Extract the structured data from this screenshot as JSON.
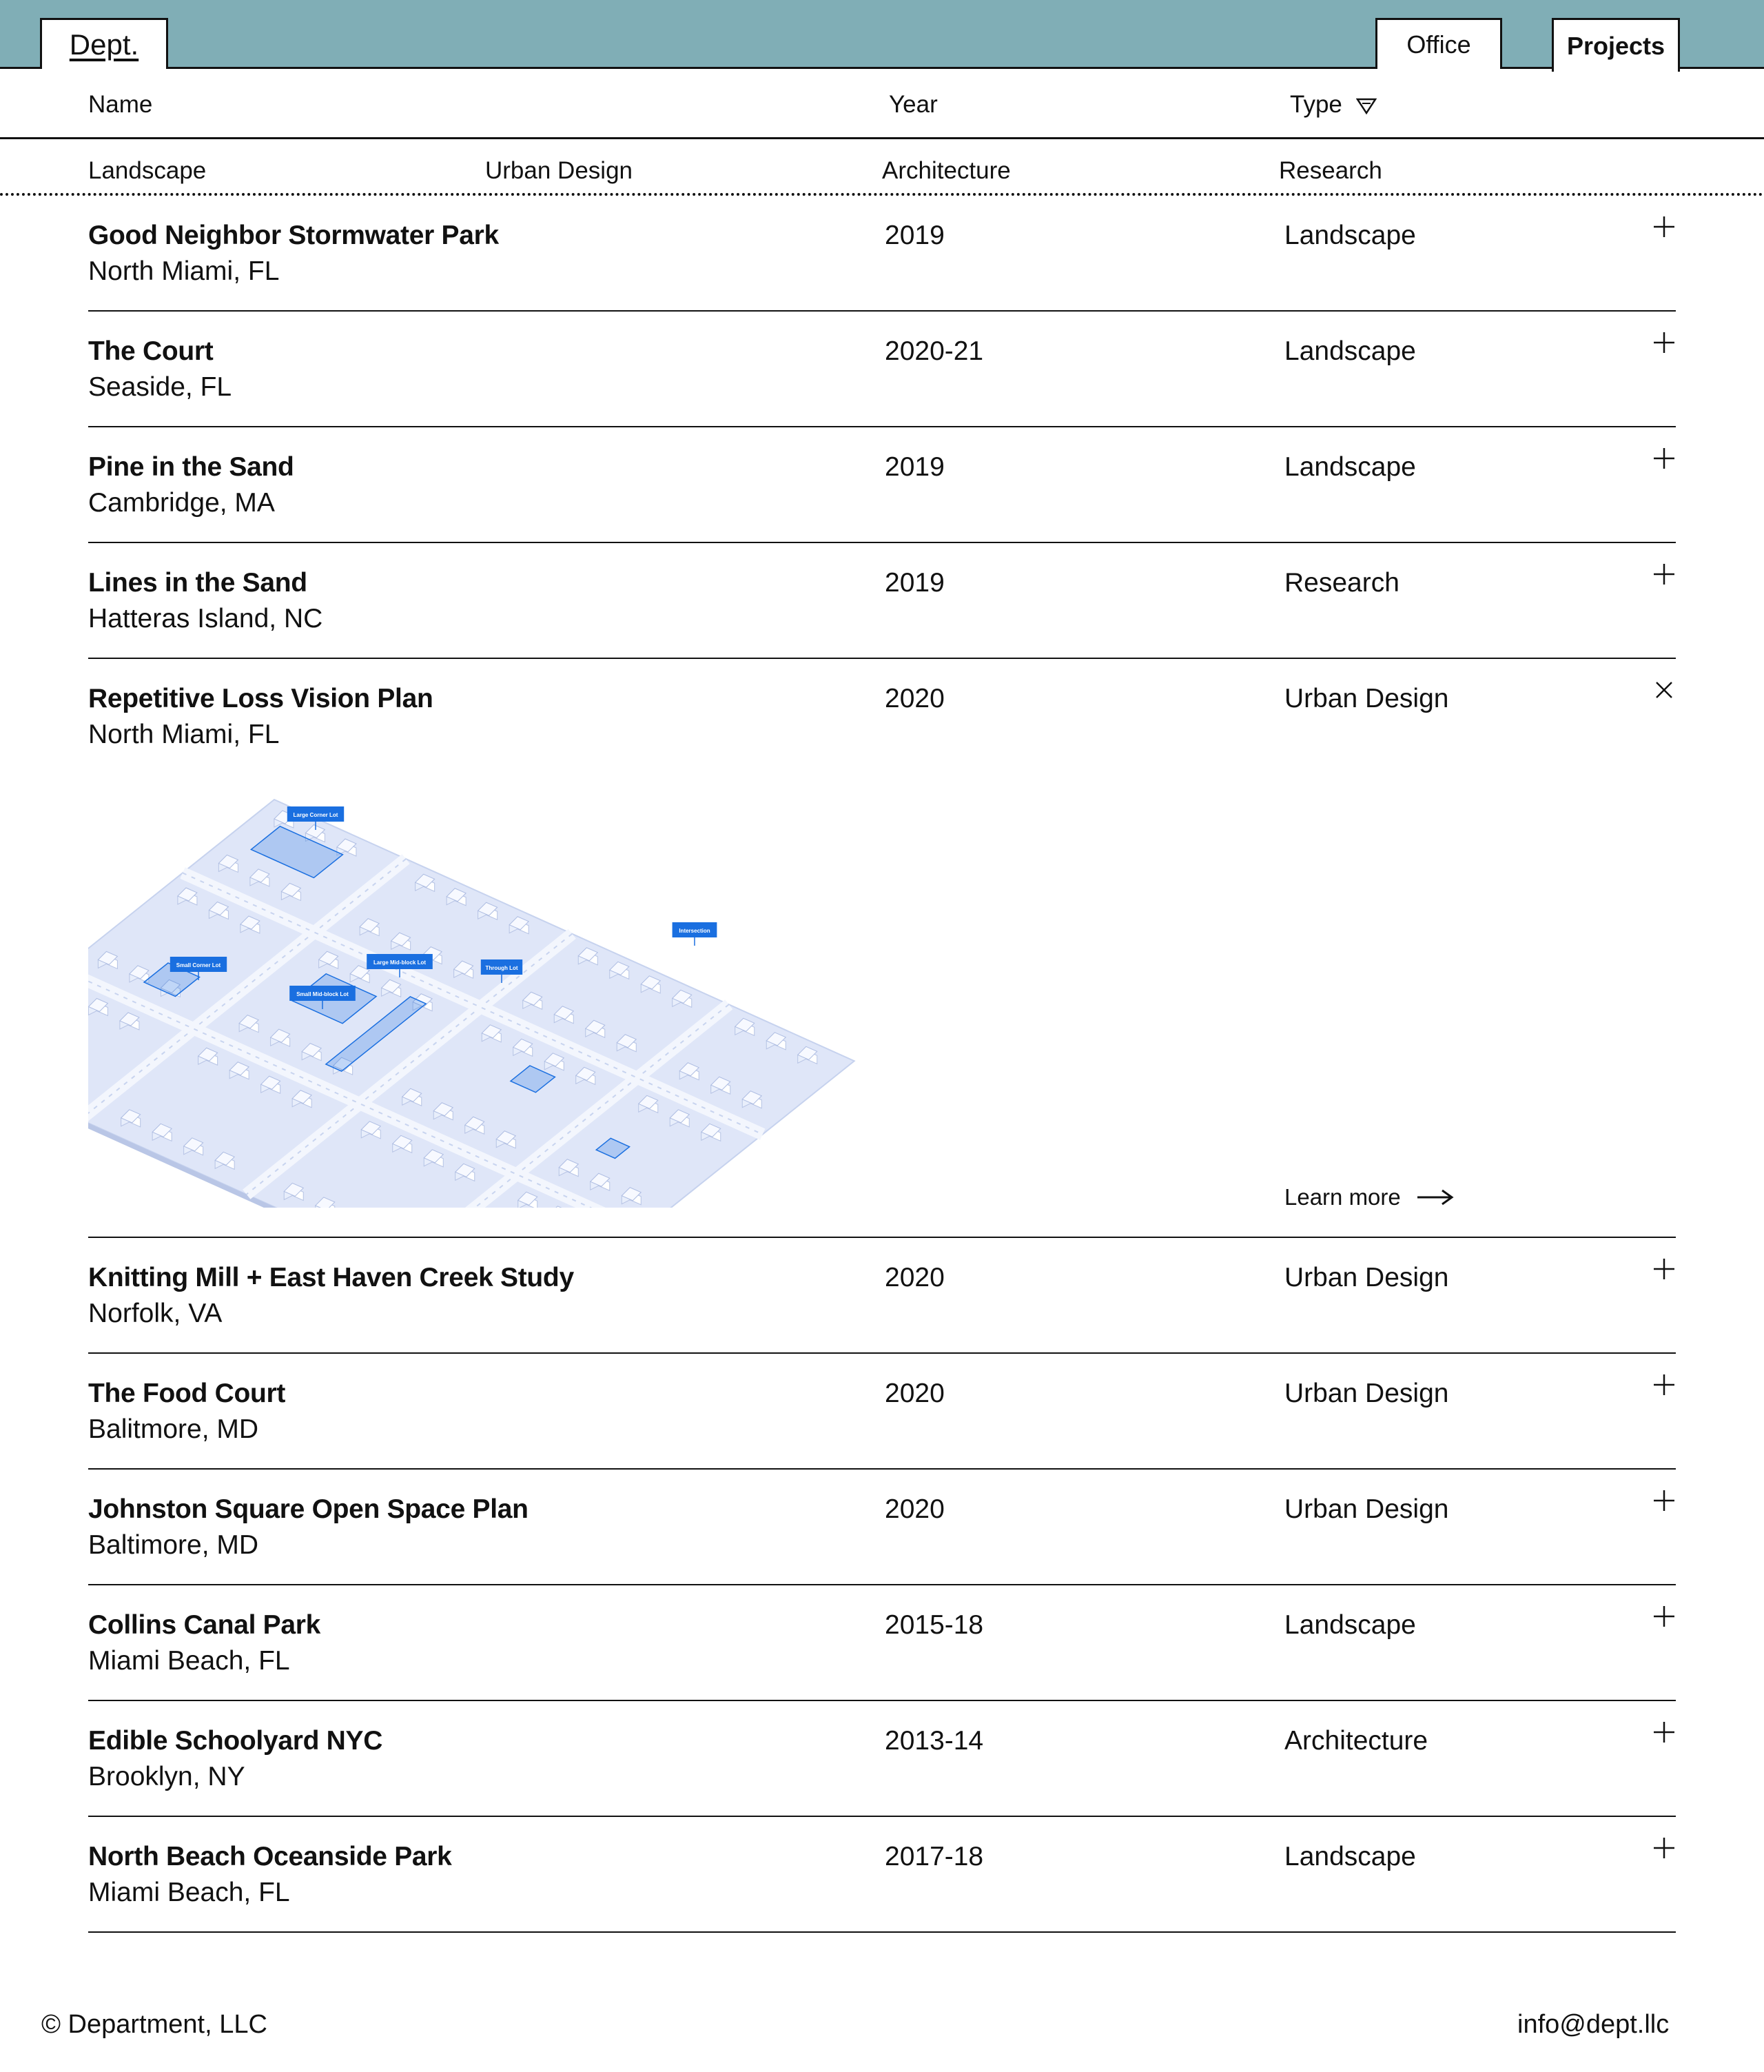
{
  "header": {
    "logo": "Dept.",
    "nav": {
      "office": "Office",
      "projects": "Projects"
    }
  },
  "columns": {
    "name": "Name",
    "year": "Year",
    "type": "Type"
  },
  "filters": [
    "Landscape",
    "Urban Design",
    "Architecture",
    "Research"
  ],
  "projects": [
    {
      "title": "Good Neighbor Stormwater Park",
      "location": "North Miami, FL",
      "year": "2019",
      "type": "Landscape",
      "expanded": false
    },
    {
      "title": "The Court",
      "location": "Seaside, FL",
      "year": "2020-21",
      "type": "Landscape",
      "expanded": false
    },
    {
      "title": "Pine in the Sand",
      "location": "Cambridge, MA",
      "year": "2019",
      "type": "Landscape",
      "expanded": false
    },
    {
      "title": "Lines in the Sand",
      "location": "Hatteras Island, NC",
      "year": "2019",
      "type": "Research",
      "expanded": false
    },
    {
      "title": "Repetitive Loss Vision Plan",
      "location": "North Miami, FL",
      "year": "2020",
      "type": "Urban Design",
      "expanded": true,
      "learn_more": "Learn more",
      "image_labels": [
        "Large Corner Lot",
        "Intersection",
        "Small Corner Lot",
        "Large Mid-block Lot",
        "Through Lot",
        "Small Mid-block Lot"
      ]
    },
    {
      "title": "Knitting Mill + East Haven Creek Study",
      "location": "Norfolk, VA",
      "year": "2020",
      "type": "Urban Design",
      "expanded": false
    },
    {
      "title": "The Food Court",
      "location": "Balitmore, MD",
      "year": "2020",
      "type": "Urban Design",
      "expanded": false
    },
    {
      "title": "Johnston Square Open Space Plan",
      "location": "Baltimore, MD",
      "year": "2020",
      "type": "Urban Design",
      "expanded": false
    },
    {
      "title": "Collins Canal Park",
      "location": "Miami Beach, FL",
      "year": "2015-18",
      "type": "Landscape",
      "expanded": false
    },
    {
      "title": "Edible Schoolyard NYC",
      "location": "Brooklyn, NY",
      "year": "2013-14",
      "type": "Architecture",
      "expanded": false
    },
    {
      "title": "North Beach Oceanside Park",
      "location": "Miami Beach, FL",
      "year": "2017-18",
      "type": "Landscape",
      "expanded": false
    }
  ],
  "footer": {
    "copyright": "© Department, LLC",
    "email": "info@dept.llc"
  },
  "colors": {
    "header_bg": "#80aeb6",
    "map_blue": "#1a6fe0",
    "map_tint": "#dfe6f8"
  }
}
